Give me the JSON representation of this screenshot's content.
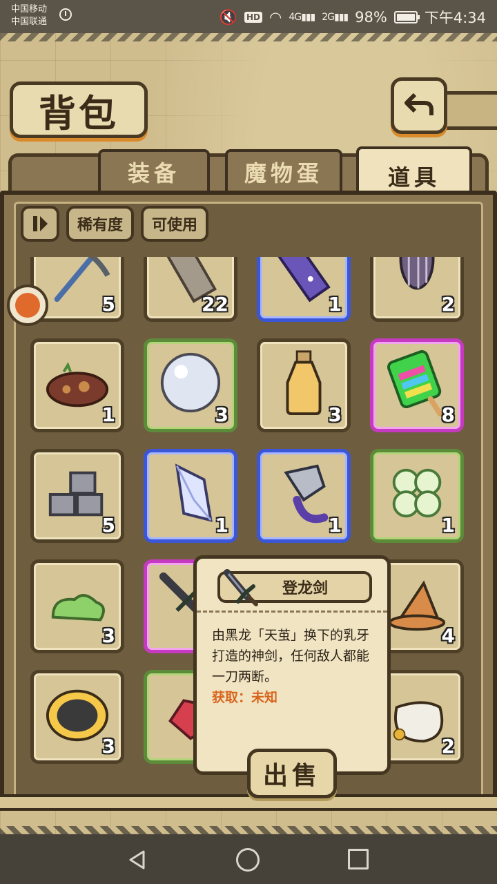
{
  "status_bar": {
    "carrier1": "中国移动",
    "carrier2": "中国联通",
    "hd": "HD",
    "net1": "4G",
    "net2": "2G",
    "battery": "98%",
    "time": "下午4:34"
  },
  "header": {
    "title": "背包"
  },
  "tabs": [
    {
      "label": "装备",
      "active": false
    },
    {
      "label": "魔物蛋",
      "active": false
    },
    {
      "label": "道具",
      "active": true
    }
  ],
  "filters": {
    "rarity": "稀有度",
    "usable": "可使用"
  },
  "items": [
    {
      "name": "pickaxe",
      "count": "5",
      "rarity": "common"
    },
    {
      "name": "stone-pillar",
      "count": "22",
      "rarity": "common"
    },
    {
      "name": "starry-crystal",
      "count": "1",
      "rarity": "blue"
    },
    {
      "name": "striped-seed",
      "count": "2",
      "rarity": "common"
    },
    {
      "name": "dirt-pile",
      "count": "1",
      "rarity": "common"
    },
    {
      "name": "pearl",
      "count": "3",
      "rarity": "green"
    },
    {
      "name": "potion-bottle",
      "count": "3",
      "rarity": "common"
    },
    {
      "name": "rainbow-popsicle",
      "count": "8",
      "rarity": "purple"
    },
    {
      "name": "stone-blocks",
      "count": "5",
      "rarity": "common"
    },
    {
      "name": "crystal-shard",
      "count": "1",
      "rarity": "blue"
    },
    {
      "name": "armored-creature",
      "count": "1",
      "rarity": "blue"
    },
    {
      "name": "four-leaf-clover",
      "count": "1",
      "rarity": "green"
    },
    {
      "name": "green-slime",
      "count": "3",
      "rarity": "common"
    },
    {
      "name": "dragon-sword",
      "count": "",
      "rarity": "purple"
    },
    {
      "name": "hidden",
      "count": "",
      "rarity": "common"
    },
    {
      "name": "witch-hat",
      "count": "4",
      "rarity": "common"
    },
    {
      "name": "woven-nest",
      "count": "3",
      "rarity": "common"
    },
    {
      "name": "red-ore",
      "count": "",
      "rarity": "green"
    },
    {
      "name": "hidden",
      "count": "",
      "rarity": "common"
    },
    {
      "name": "coin-sack",
      "count": "2",
      "rarity": "common"
    }
  ],
  "popup": {
    "name": "登龙剑",
    "description": "由黑龙「天茧」换下的乳牙打造的神剑，任何敌人都能一刀两断。",
    "source": "获取：未知",
    "sell_label": "出售"
  },
  "colors": {
    "common": "#4e3f27",
    "green": "#5c8c3a",
    "blue": "#3b56d6",
    "purple": "#c53ac0",
    "source": "#d8651e"
  }
}
